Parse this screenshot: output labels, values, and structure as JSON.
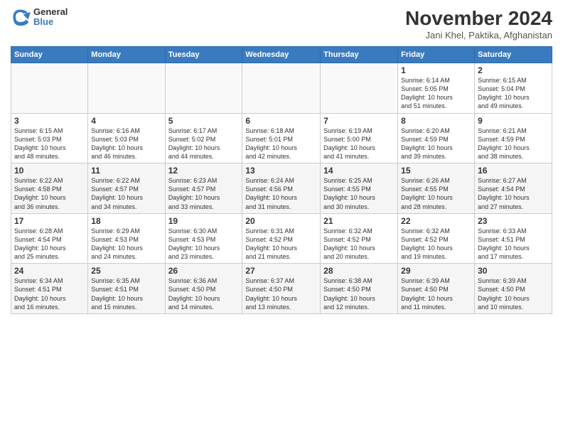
{
  "logo": {
    "general": "General",
    "blue": "Blue"
  },
  "title": "November 2024",
  "location": "Jani Khel, Paktika, Afghanistan",
  "days_of_week": [
    "Sunday",
    "Monday",
    "Tuesday",
    "Wednesday",
    "Thursday",
    "Friday",
    "Saturday"
  ],
  "weeks": [
    [
      {
        "day": "",
        "info": ""
      },
      {
        "day": "",
        "info": ""
      },
      {
        "day": "",
        "info": ""
      },
      {
        "day": "",
        "info": ""
      },
      {
        "day": "",
        "info": ""
      },
      {
        "day": "1",
        "info": "Sunrise: 6:14 AM\nSunset: 5:05 PM\nDaylight: 10 hours\nand 51 minutes."
      },
      {
        "day": "2",
        "info": "Sunrise: 6:15 AM\nSunset: 5:04 PM\nDaylight: 10 hours\nand 49 minutes."
      }
    ],
    [
      {
        "day": "3",
        "info": "Sunrise: 6:15 AM\nSunset: 5:03 PM\nDaylight: 10 hours\nand 48 minutes."
      },
      {
        "day": "4",
        "info": "Sunrise: 6:16 AM\nSunset: 5:03 PM\nDaylight: 10 hours\nand 46 minutes."
      },
      {
        "day": "5",
        "info": "Sunrise: 6:17 AM\nSunset: 5:02 PM\nDaylight: 10 hours\nand 44 minutes."
      },
      {
        "day": "6",
        "info": "Sunrise: 6:18 AM\nSunset: 5:01 PM\nDaylight: 10 hours\nand 42 minutes."
      },
      {
        "day": "7",
        "info": "Sunrise: 6:19 AM\nSunset: 5:00 PM\nDaylight: 10 hours\nand 41 minutes."
      },
      {
        "day": "8",
        "info": "Sunrise: 6:20 AM\nSunset: 4:59 PM\nDaylight: 10 hours\nand 39 minutes."
      },
      {
        "day": "9",
        "info": "Sunrise: 6:21 AM\nSunset: 4:59 PM\nDaylight: 10 hours\nand 38 minutes."
      }
    ],
    [
      {
        "day": "10",
        "info": "Sunrise: 6:22 AM\nSunset: 4:58 PM\nDaylight: 10 hours\nand 36 minutes."
      },
      {
        "day": "11",
        "info": "Sunrise: 6:22 AM\nSunset: 4:57 PM\nDaylight: 10 hours\nand 34 minutes."
      },
      {
        "day": "12",
        "info": "Sunrise: 6:23 AM\nSunset: 4:57 PM\nDaylight: 10 hours\nand 33 minutes."
      },
      {
        "day": "13",
        "info": "Sunrise: 6:24 AM\nSunset: 4:56 PM\nDaylight: 10 hours\nand 31 minutes."
      },
      {
        "day": "14",
        "info": "Sunrise: 6:25 AM\nSunset: 4:55 PM\nDaylight: 10 hours\nand 30 minutes."
      },
      {
        "day": "15",
        "info": "Sunrise: 6:26 AM\nSunset: 4:55 PM\nDaylight: 10 hours\nand 28 minutes."
      },
      {
        "day": "16",
        "info": "Sunrise: 6:27 AM\nSunset: 4:54 PM\nDaylight: 10 hours\nand 27 minutes."
      }
    ],
    [
      {
        "day": "17",
        "info": "Sunrise: 6:28 AM\nSunset: 4:54 PM\nDaylight: 10 hours\nand 25 minutes."
      },
      {
        "day": "18",
        "info": "Sunrise: 6:29 AM\nSunset: 4:53 PM\nDaylight: 10 hours\nand 24 minutes."
      },
      {
        "day": "19",
        "info": "Sunrise: 6:30 AM\nSunset: 4:53 PM\nDaylight: 10 hours\nand 23 minutes."
      },
      {
        "day": "20",
        "info": "Sunrise: 6:31 AM\nSunset: 4:52 PM\nDaylight: 10 hours\nand 21 minutes."
      },
      {
        "day": "21",
        "info": "Sunrise: 6:32 AM\nSunset: 4:52 PM\nDaylight: 10 hours\nand 20 minutes."
      },
      {
        "day": "22",
        "info": "Sunrise: 6:32 AM\nSunset: 4:52 PM\nDaylight: 10 hours\nand 19 minutes."
      },
      {
        "day": "23",
        "info": "Sunrise: 6:33 AM\nSunset: 4:51 PM\nDaylight: 10 hours\nand 17 minutes."
      }
    ],
    [
      {
        "day": "24",
        "info": "Sunrise: 6:34 AM\nSunset: 4:51 PM\nDaylight: 10 hours\nand 16 minutes."
      },
      {
        "day": "25",
        "info": "Sunrise: 6:35 AM\nSunset: 4:51 PM\nDaylight: 10 hours\nand 15 minutes."
      },
      {
        "day": "26",
        "info": "Sunrise: 6:36 AM\nSunset: 4:50 PM\nDaylight: 10 hours\nand 14 minutes."
      },
      {
        "day": "27",
        "info": "Sunrise: 6:37 AM\nSunset: 4:50 PM\nDaylight: 10 hours\nand 13 minutes."
      },
      {
        "day": "28",
        "info": "Sunrise: 6:38 AM\nSunset: 4:50 PM\nDaylight: 10 hours\nand 12 minutes."
      },
      {
        "day": "29",
        "info": "Sunrise: 6:39 AM\nSunset: 4:50 PM\nDaylight: 10 hours\nand 11 minutes."
      },
      {
        "day": "30",
        "info": "Sunrise: 6:39 AM\nSunset: 4:50 PM\nDaylight: 10 hours\nand 10 minutes."
      }
    ]
  ]
}
